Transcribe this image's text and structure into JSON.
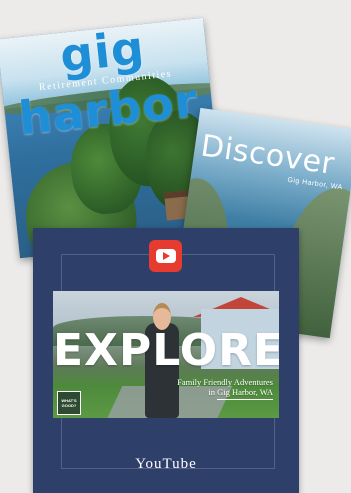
{
  "magazine_back": {
    "title": "gig harbor",
    "subtitle": "Retirement Communities"
  },
  "magazine_middle": {
    "title": "Discover",
    "subtitle": "Gig Harbor, WA"
  },
  "card": {
    "icon": "youtube-play-icon",
    "thumbnail_title": "EXPLORE",
    "thumbnail_tagline_line1": "Family Friendly Adventures",
    "thumbnail_tagline_line2": "in Gig Harbor, WA",
    "thumbnail_logo": "WHAT'S GOOD?",
    "label": "YouTube"
  },
  "colors": {
    "background": "#ecebea",
    "card": "#2e406a",
    "youtube_red": "#e63b2e",
    "title_blue": "#1e8fd6"
  }
}
